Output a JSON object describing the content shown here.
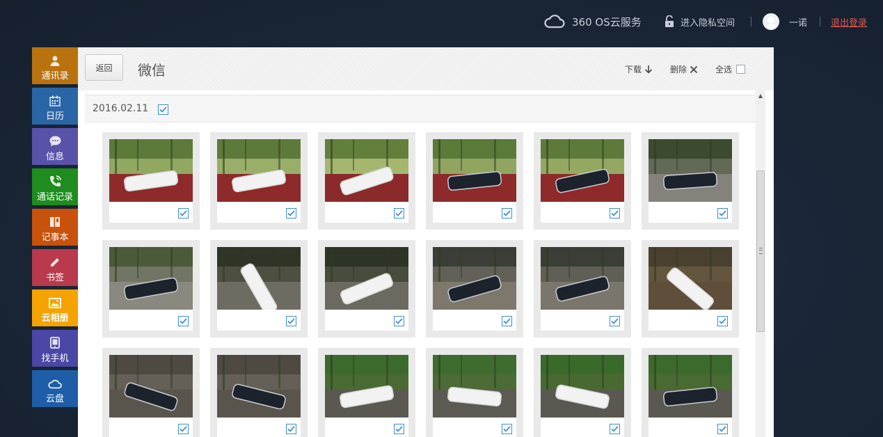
{
  "header": {
    "cloud_service": "360 OS云服务",
    "private_space": "进入隐私空间",
    "username": "一诺",
    "logout": "退出登录"
  },
  "sidebar": {
    "items": [
      {
        "label": "通讯录",
        "icon": "user-icon",
        "color": "#b8730f"
      },
      {
        "label": "日历",
        "icon": "calendar-icon",
        "color": "#2a66a6"
      },
      {
        "label": "信息",
        "icon": "message-icon",
        "color": "#5852a9"
      },
      {
        "label": "通话记录",
        "icon": "phone-icon",
        "color": "#1e8c1e"
      },
      {
        "label": "记事本",
        "icon": "notebook-icon",
        "color": "#c8510c"
      },
      {
        "label": "书签",
        "icon": "pencil-icon",
        "color": "#b83a4c"
      },
      {
        "label": "云相册",
        "icon": "picture-icon",
        "color": "#f5a300"
      },
      {
        "label": "找手机",
        "icon": "tablet-icon",
        "color": "#4a47a6"
      },
      {
        "label": "云盘",
        "icon": "cloud-icon",
        "color": "#1e5ea8"
      }
    ],
    "active_index": 6
  },
  "panel": {
    "back_label": "返回",
    "title": "微信",
    "download_label": "下载",
    "delete_label": "删除",
    "select_all_label": "全选",
    "date": "2016.02.11"
  },
  "colors": {
    "accent_checkbox": "#3c8dd6",
    "logout": "#e0574a"
  }
}
